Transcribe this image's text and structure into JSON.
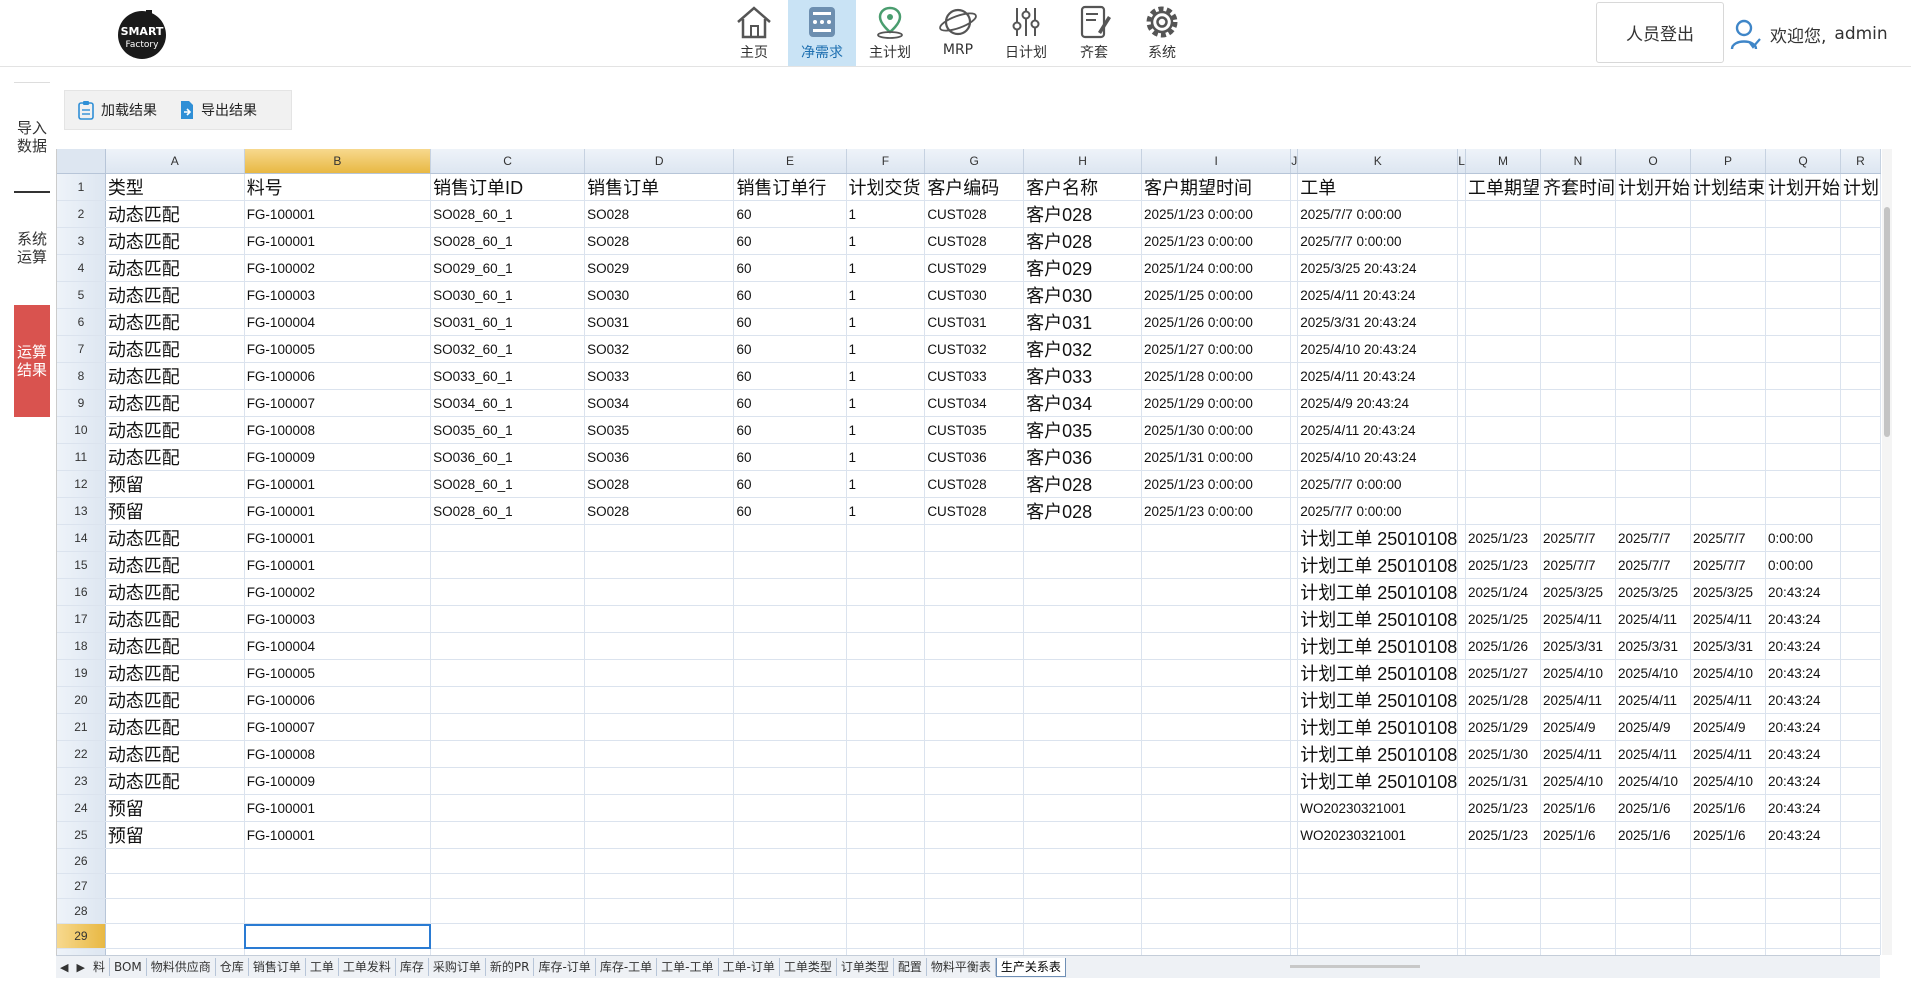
{
  "header": {
    "logo_text": "SMART Factory",
    "nav": [
      {
        "label": "主页",
        "icon": "home-icon"
      },
      {
        "label": "净需求",
        "icon": "calculator-icon"
      },
      {
        "label": "主计划",
        "icon": "location-pin-icon"
      },
      {
        "label": "MRP",
        "icon": "planet-icon"
      },
      {
        "label": "日计划",
        "icon": "sliders-icon"
      },
      {
        "label": "齐套",
        "icon": "document-edit-icon"
      },
      {
        "label": "系统",
        "icon": "gear-icon"
      }
    ],
    "active_nav": "净需求",
    "logout_label": "人员登出",
    "welcome_text": "欢迎您,",
    "username": "admin"
  },
  "side_tabs": [
    {
      "label": "导入\n数据"
    },
    {
      "label": "系统\n运算"
    },
    {
      "label": "运算\n结果"
    }
  ],
  "toolbar": {
    "load_label": "加载结果",
    "export_label": "导出结果"
  },
  "sheet": {
    "columns": [
      "A",
      "B",
      "C",
      "D",
      "E",
      "F",
      "G",
      "H",
      "I",
      "J",
      "K",
      "L",
      "M",
      "N",
      "O",
      "P",
      "Q",
      "R"
    ],
    "selected_column": "B",
    "selected_row": 29,
    "rows": [
      [
        "类型",
        "料号",
        "销售订单ID",
        "销售订单",
        "销售订单行",
        "计划交货",
        "客户编码",
        "客户名称",
        "客户期望时间",
        "",
        "工单",
        "",
        "工单期望",
        "齐套时间",
        "计划开始",
        "计划结束",
        "计划开始",
        "计划"
      ],
      [
        "动态匹配",
        "FG-100001",
        "SO028_60_1",
        "SO028",
        "60",
        "1",
        "CUST028",
        "客户028",
        "2025/1/23 0:00:00",
        "",
        "2025/7/7 0:00:00",
        "",
        "",
        "",
        "",
        "",
        "",
        ""
      ],
      [
        "动态匹配",
        "FG-100001",
        "SO028_60_1",
        "SO028",
        "60",
        "1",
        "CUST028",
        "客户028",
        "2025/1/23 0:00:00",
        "",
        "2025/7/7 0:00:00",
        "",
        "",
        "",
        "",
        "",
        "",
        ""
      ],
      [
        "动态匹配",
        "FG-100002",
        "SO029_60_1",
        "SO029",
        "60",
        "1",
        "CUST029",
        "客户029",
        "2025/1/24 0:00:00",
        "",
        "2025/3/25 20:43:24",
        "",
        "",
        "",
        "",
        "",
        "",
        ""
      ],
      [
        "动态匹配",
        "FG-100003",
        "SO030_60_1",
        "SO030",
        "60",
        "1",
        "CUST030",
        "客户030",
        "2025/1/25 0:00:00",
        "",
        "2025/4/11 20:43:24",
        "",
        "",
        "",
        "",
        "",
        "",
        ""
      ],
      [
        "动态匹配",
        "FG-100004",
        "SO031_60_1",
        "SO031",
        "60",
        "1",
        "CUST031",
        "客户031",
        "2025/1/26 0:00:00",
        "",
        "2025/3/31 20:43:24",
        "",
        "",
        "",
        "",
        "",
        "",
        ""
      ],
      [
        "动态匹配",
        "FG-100005",
        "SO032_60_1",
        "SO032",
        "60",
        "1",
        "CUST032",
        "客户032",
        "2025/1/27 0:00:00",
        "",
        "2025/4/10 20:43:24",
        "",
        "",
        "",
        "",
        "",
        "",
        ""
      ],
      [
        "动态匹配",
        "FG-100006",
        "SO033_60_1",
        "SO033",
        "60",
        "1",
        "CUST033",
        "客户033",
        "2025/1/28 0:00:00",
        "",
        "2025/4/11 20:43:24",
        "",
        "",
        "",
        "",
        "",
        "",
        ""
      ],
      [
        "动态匹配",
        "FG-100007",
        "SO034_60_1",
        "SO034",
        "60",
        "1",
        "CUST034",
        "客户034",
        "2025/1/29 0:00:00",
        "",
        "2025/4/9 20:43:24",
        "",
        "",
        "",
        "",
        "",
        "",
        ""
      ],
      [
        "动态匹配",
        "FG-100008",
        "SO035_60_1",
        "SO035",
        "60",
        "1",
        "CUST035",
        "客户035",
        "2025/1/30 0:00:00",
        "",
        "2025/4/11 20:43:24",
        "",
        "",
        "",
        "",
        "",
        "",
        ""
      ],
      [
        "动态匹配",
        "FG-100009",
        "SO036_60_1",
        "SO036",
        "60",
        "1",
        "CUST036",
        "客户036",
        "2025/1/31 0:00:00",
        "",
        "2025/4/10 20:43:24",
        "",
        "",
        "",
        "",
        "",
        "",
        ""
      ],
      [
        "预留",
        "FG-100001",
        "SO028_60_1",
        "SO028",
        "60",
        "1",
        "CUST028",
        "客户028",
        "2025/1/23 0:00:00",
        "",
        "2025/7/7 0:00:00",
        "",
        "",
        "",
        "",
        "",
        "",
        ""
      ],
      [
        "预留",
        "FG-100001",
        "SO028_60_1",
        "SO028",
        "60",
        "1",
        "CUST028",
        "客户028",
        "2025/1/23 0:00:00",
        "",
        "2025/7/7 0:00:00",
        "",
        "",
        "",
        "",
        "",
        "",
        ""
      ],
      [
        "动态匹配",
        "FG-100001",
        "",
        "",
        "",
        "",
        "",
        "",
        "",
        "",
        "计划工单 25010108",
        "",
        "2025/1/23",
        "2025/7/7",
        "2025/7/7",
        "2025/7/7",
        "0:00:00",
        ""
      ],
      [
        "动态匹配",
        "FG-100001",
        "",
        "",
        "",
        "",
        "",
        "",
        "",
        "",
        "计划工单 25010108",
        "",
        "2025/1/23",
        "2025/7/7",
        "2025/7/7",
        "2025/7/7",
        "0:00:00",
        ""
      ],
      [
        "动态匹配",
        "FG-100002",
        "",
        "",
        "",
        "",
        "",
        "",
        "",
        "",
        "计划工单 25010108",
        "",
        "2025/1/24",
        "2025/3/25",
        "2025/3/25",
        "2025/3/25",
        "20:43:24",
        ""
      ],
      [
        "动态匹配",
        "FG-100003",
        "",
        "",
        "",
        "",
        "",
        "",
        "",
        "",
        "计划工单 25010108",
        "",
        "2025/1/25",
        "2025/4/11",
        "2025/4/11",
        "2025/4/11",
        "20:43:24",
        ""
      ],
      [
        "动态匹配",
        "FG-100004",
        "",
        "",
        "",
        "",
        "",
        "",
        "",
        "",
        "计划工单 25010108",
        "",
        "2025/1/26",
        "2025/3/31",
        "2025/3/31",
        "2025/3/31",
        "20:43:24",
        ""
      ],
      [
        "动态匹配",
        "FG-100005",
        "",
        "",
        "",
        "",
        "",
        "",
        "",
        "",
        "计划工单 25010108",
        "",
        "2025/1/27",
        "2025/4/10",
        "2025/4/10",
        "2025/4/10",
        "20:43:24",
        ""
      ],
      [
        "动态匹配",
        "FG-100006",
        "",
        "",
        "",
        "",
        "",
        "",
        "",
        "",
        "计划工单 25010108",
        "",
        "2025/1/28",
        "2025/4/11",
        "2025/4/11",
        "2025/4/11",
        "20:43:24",
        ""
      ],
      [
        "动态匹配",
        "FG-100007",
        "",
        "",
        "",
        "",
        "",
        "",
        "",
        "",
        "计划工单 25010108",
        "",
        "2025/1/29",
        "2025/4/9",
        "2025/4/9",
        "2025/4/9",
        "20:43:24",
        ""
      ],
      [
        "动态匹配",
        "FG-100008",
        "",
        "",
        "",
        "",
        "",
        "",
        "",
        "",
        "计划工单 25010108",
        "",
        "2025/1/30",
        "2025/4/11",
        "2025/4/11",
        "2025/4/11",
        "20:43:24",
        ""
      ],
      [
        "动态匹配",
        "FG-100009",
        "",
        "",
        "",
        "",
        "",
        "",
        "",
        "",
        "计划工单 25010108",
        "",
        "2025/1/31",
        "2025/4/10",
        "2025/4/10",
        "2025/4/10",
        "20:43:24",
        ""
      ],
      [
        "预留",
        "FG-100001",
        "",
        "",
        "",
        "",
        "",
        "",
        "",
        "",
        "WO20230321001",
        "",
        "2025/1/23",
        "2025/1/6",
        "2025/1/6",
        "2025/1/6",
        "20:43:24",
        ""
      ],
      [
        "预留",
        "FG-100001",
        "",
        "",
        "",
        "",
        "",
        "",
        "",
        "",
        "WO20230321001",
        "",
        "2025/1/23",
        "2025/1/6",
        "2025/1/6",
        "2025/1/6",
        "20:43:24",
        ""
      ],
      [
        "",
        "",
        "",
        "",
        "",
        "",
        "",
        "",
        "",
        "",
        "",
        "",
        "",
        "",
        "",
        "",
        "",
        ""
      ],
      [
        "",
        "",
        "",
        "",
        "",
        "",
        "",
        "",
        "",
        "",
        "",
        "",
        "",
        "",
        "",
        "",
        "",
        ""
      ],
      [
        "",
        "",
        "",
        "",
        "",
        "",
        "",
        "",
        "",
        "",
        "",
        "",
        "",
        "",
        "",
        "",
        "",
        ""
      ],
      [
        "",
        "",
        "",
        "",
        "",
        "",
        "",
        "",
        "",
        "",
        "",
        "",
        "",
        "",
        "",
        "",
        "",
        ""
      ],
      [
        "",
        "",
        "",
        "",
        "",
        "",
        "",
        "",
        "",
        "",
        "",
        "",
        "",
        "",
        "",
        "",
        "",
        ""
      ],
      [
        "",
        "",
        "",
        "",
        "",
        "",
        "",
        "",
        "",
        "",
        "",
        "",
        "",
        "",
        "",
        "",
        "",
        ""
      ],
      [
        "",
        "",
        "",
        "",
        "",
        "",
        "",
        "",
        "",
        "",
        "",
        "",
        "",
        "",
        "",
        "",
        "",
        ""
      ]
    ],
    "tabs": [
      "料",
      "BOM",
      "物料供应商",
      "仓库",
      "销售订单",
      "工单",
      "工单发料",
      "库存",
      "采购订单",
      "新的PR",
      "库存-订单",
      "库存-工单",
      "工单-工单",
      "工单-订单",
      "工单类型",
      "订单类型",
      "配置",
      "物料平衡表",
      "生产关系表"
    ],
    "active_tab": "生产关系表"
  },
  "colors": {
    "active_nav_bg": "#c9e3f5",
    "active_side_tab": "#d9534f",
    "selection": "#2a7bd3",
    "selected_header": "#e8b843"
  }
}
